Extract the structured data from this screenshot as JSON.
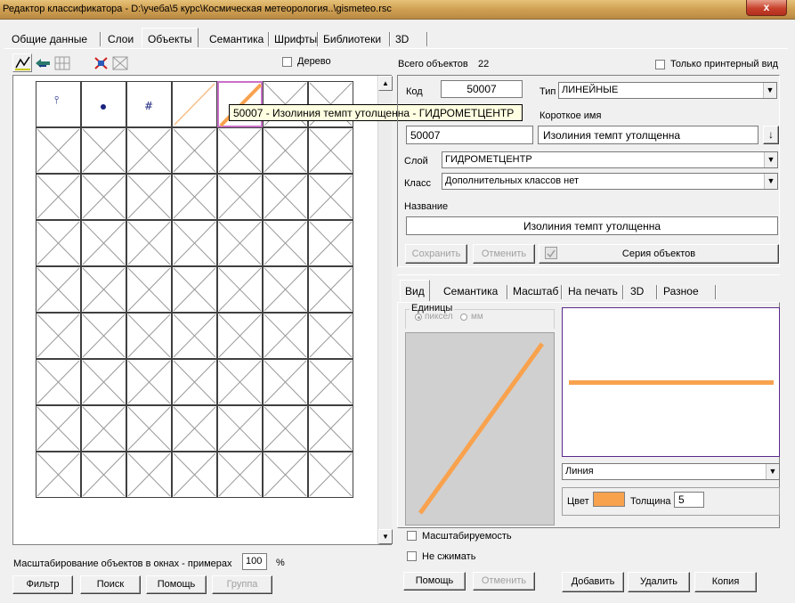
{
  "window": {
    "title": "Редактор классификатора - D:\\учеба\\5 курс\\Космическая метеорология..\\gismeteo.rsc",
    "close_label": "x"
  },
  "tabs": [
    "Общие данные",
    "Слои",
    "Объекты",
    "Семантика",
    "Шрифты",
    "Библиотеки",
    "3D"
  ],
  "active_tab": "Объекты",
  "left": {
    "tree_label": "Дерево",
    "tooltip": "50007 - Изолиния темпт утолщенна - ГИДРОМЕТЦЕНТР",
    "scale_label": "Масштабирование объектов в окнах - примерах",
    "scale_value": "100",
    "scale_unit": "%",
    "buttons": {
      "filter": "Фильтр",
      "search": "Поиск",
      "help": "Помощь",
      "group": "Группа"
    }
  },
  "right": {
    "total_label": "Всего объектов",
    "total_value": "22",
    "printer_only_label": "Только принтерный вид",
    "code_label": "Код",
    "code_value": "50007",
    "type_label": "Тип",
    "type_value": "ЛИНЕЙНЫЕ",
    "short_name_label": "Короткое имя",
    "short_code": "50007",
    "short_name_value": "Изолиния темпт утолщенна",
    "layer_label": "Слой",
    "layer_value": "ГИДРОМЕТЦЕНТР",
    "class_label": "Класс",
    "class_value": "Дополнительных классов нет",
    "name_label": "Название",
    "name_value": "Изолиния темпт утолщенна",
    "save_button": "Сохранить",
    "cancel_button": "Отменить",
    "series_button": "Серия объектов",
    "inner_tabs": [
      "Вид",
      "Семантика",
      "Масштаб",
      "На печать",
      "3D",
      "Разное"
    ],
    "units_label": "Единицы",
    "unit_pixel": "пиксел",
    "unit_mm": "мм",
    "line_type_value": "Линия",
    "color_label": "Цвет",
    "thickness_label": "Толщина",
    "thickness_value": "5",
    "line_color": "#f8a24e",
    "scalable_label": "Масштабируемость",
    "no_compress_label": "Не сжимать",
    "bottom_buttons": {
      "help": "Помощь",
      "cancel": "Отменить",
      "add": "Добавить",
      "delete": "Удалить",
      "copy": "Копия"
    }
  }
}
